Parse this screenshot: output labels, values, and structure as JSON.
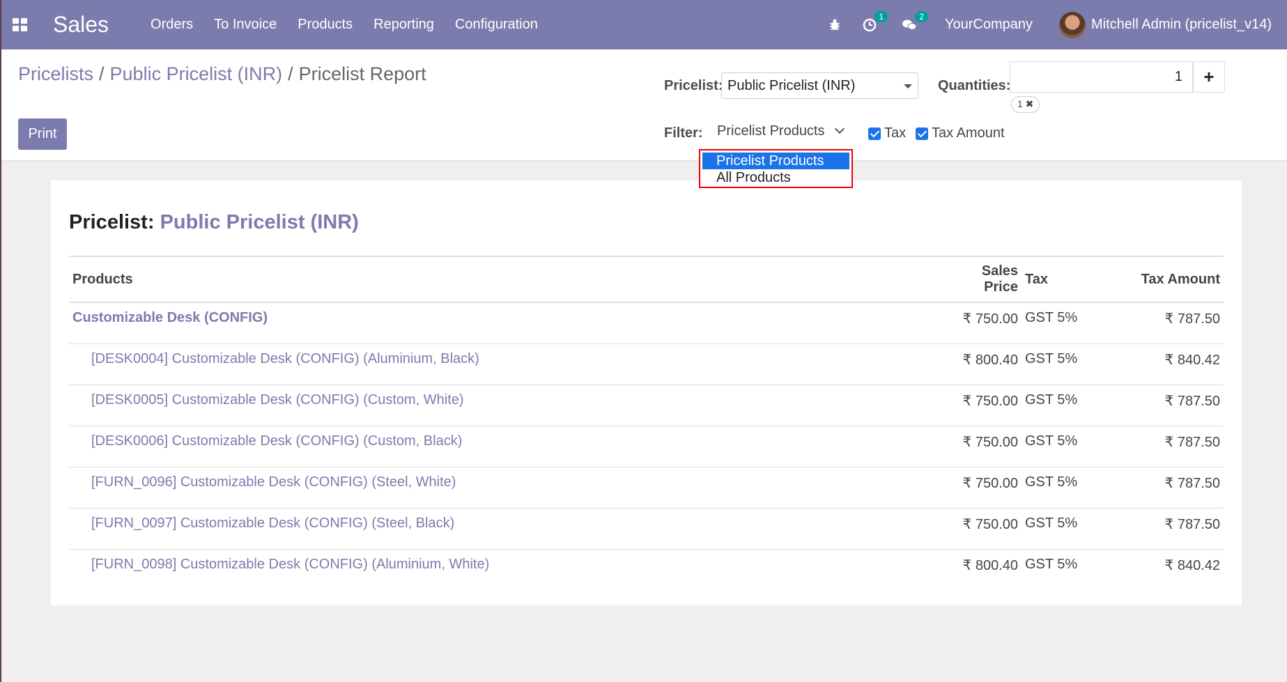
{
  "navbar": {
    "brand": "Sales",
    "menu": [
      "Orders",
      "To Invoice",
      "Products",
      "Reporting",
      "Configuration"
    ],
    "activity_count": "1",
    "messages_count": "2",
    "company": "YourCompany",
    "user": "Mitchell Admin (pricelist_v14)"
  },
  "breadcrumb": {
    "items": [
      "Pricelists",
      "Public Pricelist (INR)",
      "Pricelist Report"
    ]
  },
  "controls": {
    "print_label": "Print",
    "pricelist_label": "Pricelist:",
    "pricelist_value": "Public Pricelist (INR)",
    "quantities_label": "Quantities:",
    "quantity_value": "1",
    "quantity_tag": "1 ✖",
    "filter_label": "Filter:",
    "filter_value": "Pricelist Products",
    "filter_options": [
      "Pricelist Products",
      "All Products"
    ],
    "tax_label": "Tax",
    "tax_amount_label": "Tax Amount"
  },
  "report": {
    "title_prefix": "Pricelist:",
    "title_value": "Public Pricelist (INR)",
    "columns": [
      "Products",
      "Sales Price",
      "Tax",
      "Tax Amount"
    ],
    "rows": [
      {
        "product": "Customizable Desk (CONFIG)",
        "price": "₹ 750.00",
        "tax": "GST 5%",
        "amount": "₹ 787.50",
        "main": true
      },
      {
        "product": "[DESK0004] Customizable Desk (CONFIG) (Aluminium, Black)",
        "price": "₹ 800.40",
        "tax": "GST 5%",
        "amount": "₹ 840.42"
      },
      {
        "product": "[DESK0005] Customizable Desk (CONFIG) (Custom, White)",
        "price": "₹ 750.00",
        "tax": "GST 5%",
        "amount": "₹ 787.50"
      },
      {
        "product": "[DESK0006] Customizable Desk (CONFIG) (Custom, Black)",
        "price": "₹ 750.00",
        "tax": "GST 5%",
        "amount": "₹ 787.50"
      },
      {
        "product": "[FURN_0096] Customizable Desk (CONFIG) (Steel, White)",
        "price": "₹ 750.00",
        "tax": "GST 5%",
        "amount": "₹ 787.50"
      },
      {
        "product": "[FURN_0097] Customizable Desk (CONFIG) (Steel, Black)",
        "price": "₹ 750.00",
        "tax": "GST 5%",
        "amount": "₹ 787.50"
      },
      {
        "product": "[FURN_0098] Customizable Desk (CONFIG) (Aluminium, White)",
        "price": "₹ 800.40",
        "tax": "GST 5%",
        "amount": "₹ 840.42"
      }
    ]
  }
}
